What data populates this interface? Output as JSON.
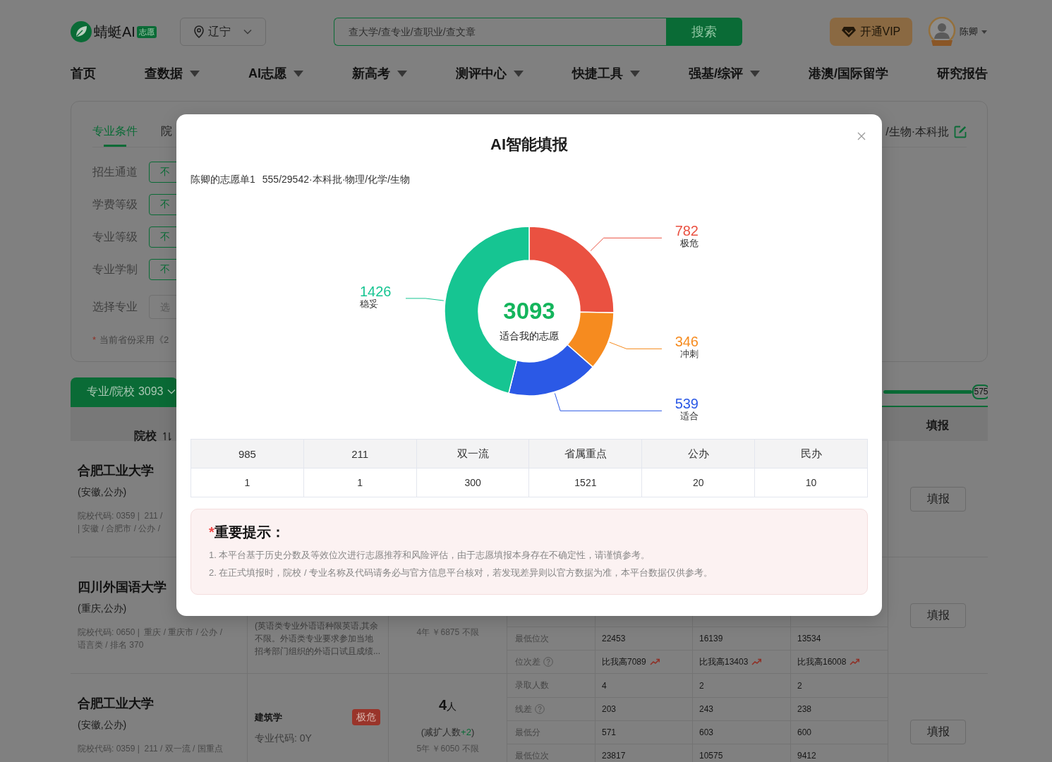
{
  "header": {
    "logo": {
      "text": "蜻蜓AI",
      "badge": "志愿"
    },
    "location": {
      "value": "辽宁"
    },
    "search": {
      "placeholder": "查大学/查专业/查职业/查文章",
      "button": "搜索"
    },
    "vip_button": "开通VIP",
    "user": {
      "name": "陈卿"
    }
  },
  "nav": [
    {
      "label": "首页",
      "dropdown": false
    },
    {
      "label": "查数据",
      "dropdown": true
    },
    {
      "label": "AI志愿",
      "dropdown": true
    },
    {
      "label": "新高考",
      "dropdown": true
    },
    {
      "label": "测评中心",
      "dropdown": true
    },
    {
      "label": "快捷工具",
      "dropdown": true
    },
    {
      "label": "强基/综评",
      "dropdown": true
    },
    {
      "label": "港澳/国际留学",
      "dropdown": false
    },
    {
      "label": "研究报告",
      "dropdown": false
    }
  ],
  "filter_card": {
    "tabs": [
      {
        "label": "专业条件",
        "selected": true
      },
      {
        "label": "院",
        "selected": false
      }
    ],
    "summary": "/生物·本科批",
    "filters": [
      {
        "kind": "option",
        "label": "招生通道",
        "value": "不"
      },
      {
        "kind": "option",
        "label": "学费等级",
        "value": "不"
      },
      {
        "kind": "option",
        "label": "专业等级",
        "value": "不"
      },
      {
        "kind": "option",
        "label": "专业学制",
        "value": "不"
      },
      {
        "kind": "select",
        "label": "选择专业",
        "placeholder": "选"
      }
    ],
    "note": {
      "mark": "*",
      "text": "当前省份采用《2"
    }
  },
  "results": {
    "tab": "专业/院校 3093",
    "score_slider": {
      "level": 1,
      "value": "575"
    },
    "columns": [
      {
        "kind": "school",
        "label": "院校",
        "sortable": true
      },
      {
        "kind": "action",
        "label": "填报",
        "sortable": false
      }
    ],
    "rows": [
      {
        "school": "合肥工业大学",
        "region": "(安徽,公办)",
        "info": [
          "院校代码: 0359 |  211 /",
          "| 安徽 / 合肥市 / 公办 /"
        ],
        "action": "填报"
      },
      {
        "school": "四川外国语大学",
        "region": "(重庆,公办)",
        "info": [
          "院校代码: 0650 |  重庆 / 重庆市 / 公办 /",
          "语言类 / 排名 370"
        ],
        "major": {
          "kind": "note",
          "note": "(英语类专业外语语种限英语,其余不限。外语类专业要求参加当地招考部门组织的外语口试且成绩..."
        },
        "plan": {
          "terms": "4年 ￥6875 不限"
        },
        "metrics": [
          {
            "label": "最低位次",
            "help": false,
            "trend_up": false,
            "values": [
              "22453",
              "16139",
              "13534"
            ]
          },
          {
            "label": "位次差",
            "help": true,
            "trend_up": true,
            "values": [
              "比我高7089",
              "比我高13403",
              "比我高16008"
            ]
          }
        ],
        "action": "填报"
      },
      {
        "school": "合肥工业大学",
        "region": "(安徽,公办)",
        "info": [
          "院校代码: 0359 |  211 / 双一流 / 国重点"
        ],
        "major": {
          "kind": "major",
          "name": "建筑学",
          "tag": {
            "text": "极危",
            "color": "#99342a"
          },
          "code": "专业代码: 0Y"
        },
        "plan": {
          "count": "4",
          "unit": "人",
          "change": {
            "prefix": "(减扩人数",
            "value": "+2",
            "suffix": ")",
            "kind": "increase"
          },
          "terms": "5年 ￥6050 不限"
        },
        "metrics": [
          {
            "label": "录取人数",
            "help": false,
            "trend_up": false,
            "values": [
              "4",
              "2",
              "2"
            ]
          },
          {
            "label": "线差",
            "help": true,
            "trend_up": false,
            "values": [
              "203",
              "243",
              "238"
            ]
          },
          {
            "label": "最低分",
            "help": false,
            "trend_up": false,
            "values": [
              "571",
              "603",
              "600"
            ]
          },
          {
            "label": "最低位次",
            "help": false,
            "trend_up": false,
            "values": [
              "23817",
              "10575",
              "9412"
            ]
          }
        ],
        "action": "填报"
      }
    ]
  },
  "modal": {
    "title": "AI智能填报",
    "list_name": "陈卿的志愿单1",
    "profile": "555/29542·本科批·物理/化学/生物",
    "chart_data": {
      "type": "donut",
      "categories": [
        "极危",
        "冲刺",
        "适合",
        "稳妥"
      ],
      "values": [
        782,
        346,
        539,
        1426
      ],
      "colors": [
        "#ea5141",
        "#f68b1f",
        "#2b59e6",
        "#16c592"
      ],
      "data_labels": true
    },
    "center_value": "3093",
    "center_label": "适合我的志愿",
    "stats": {
      "columns": [
        "985",
        "211",
        "双一流",
        "省属重点",
        "公办",
        "民办"
      ],
      "values": [
        "1",
        "1",
        "300",
        "1521",
        "20",
        "10"
      ]
    },
    "notice": {
      "mark": "*",
      "title": "重要提示：",
      "lines": [
        "1. 本平台基于历史分数及等效位次进行志愿推荐和风险评估，由于志愿填报本身存在不确定性，请谨慎参考。",
        "2. 在正式填报时，院校 / 专业名称及代码请务必与官方信息平台核对，若发现差异则以官方数据为准，本平台数据仅供参考。"
      ]
    }
  }
}
